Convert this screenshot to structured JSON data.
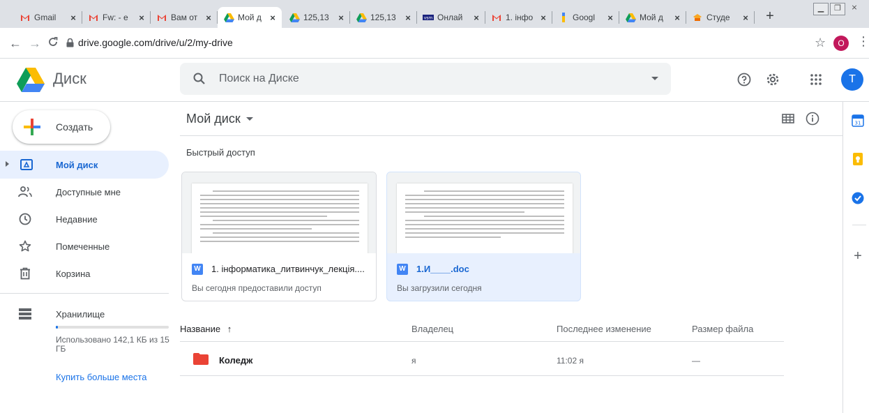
{
  "browser": {
    "tabs": [
      {
        "icon": "gmail-icon",
        "label": "Gmail"
      },
      {
        "icon": "gmail-icon",
        "label": "Fw: - e"
      },
      {
        "icon": "gmail-icon",
        "label": "Вам от"
      },
      {
        "icon": "drive-icon",
        "label": "Мой д",
        "active": true
      },
      {
        "icon": "drive-icon",
        "label": "125,13"
      },
      {
        "icon": "drive-icon",
        "label": "125,13"
      },
      {
        "icon": "vsm-icon",
        "label": "Онлай"
      },
      {
        "icon": "gmail-icon",
        "label": "1. інфо"
      },
      {
        "icon": "google-icon",
        "label": "Googl"
      },
      {
        "icon": "drive-icon",
        "label": "Мой д"
      },
      {
        "icon": "student-icon",
        "label": "Студе"
      }
    ],
    "new_tab": "+",
    "close_glyph": "×",
    "url": "drive.google.com/drive/u/2/my-drive",
    "profile_initial": "O",
    "colors": {
      "tabbar": "#dee1e6",
      "profile": "#c2185b"
    }
  },
  "drive": {
    "brand": "Диск",
    "search": {
      "placeholder": "Поиск на Диске"
    },
    "avatar_initial": "T"
  },
  "sidebar": {
    "create_label": "Создать",
    "items": [
      {
        "label": "Мой диск",
        "icon": "my-drive-icon",
        "active": true
      },
      {
        "label": "Доступные мне",
        "icon": "shared-with-me-icon"
      },
      {
        "label": "Недавние",
        "icon": "recent-clock-icon"
      },
      {
        "label": "Помеченные",
        "icon": "star-icon"
      },
      {
        "label": "Корзина",
        "icon": "trash-icon"
      }
    ],
    "storage": {
      "label": "Хранилище",
      "used_text": "Использовано 142,1 КБ из 15 ГБ",
      "used_fraction": 0.02
    },
    "buy_more": "Купить больше места"
  },
  "main": {
    "title": "Мой диск",
    "quick_access_title": "Быстрый доступ",
    "quick_access": [
      {
        "name": "1. інформатика_литвинчук_лекція....",
        "subtitle": "Вы сегодня предоставили доступ",
        "type": "W"
      },
      {
        "name": "1.И____.doc",
        "subtitle": "Вы загрузили сегодня",
        "type": "W",
        "selected": true
      }
    ],
    "columns": {
      "name": "Название",
      "sort_arrow": "↑",
      "owner": "Владелец",
      "modified": "Последнее изменение",
      "size": "Размер файла"
    },
    "rows": [
      {
        "name": "Коледж",
        "owner": "я",
        "modified": "11:02 я",
        "size": "—"
      }
    ]
  },
  "right_panel": {
    "icons": [
      "calendar-icon",
      "keep-icon",
      "tasks-icon",
      "add-addon-icon"
    ],
    "add_glyph": "+"
  },
  "colors": {
    "accent": "#1a73e8",
    "active_bg": "#e8f0fe",
    "folder": "#ea4335"
  }
}
